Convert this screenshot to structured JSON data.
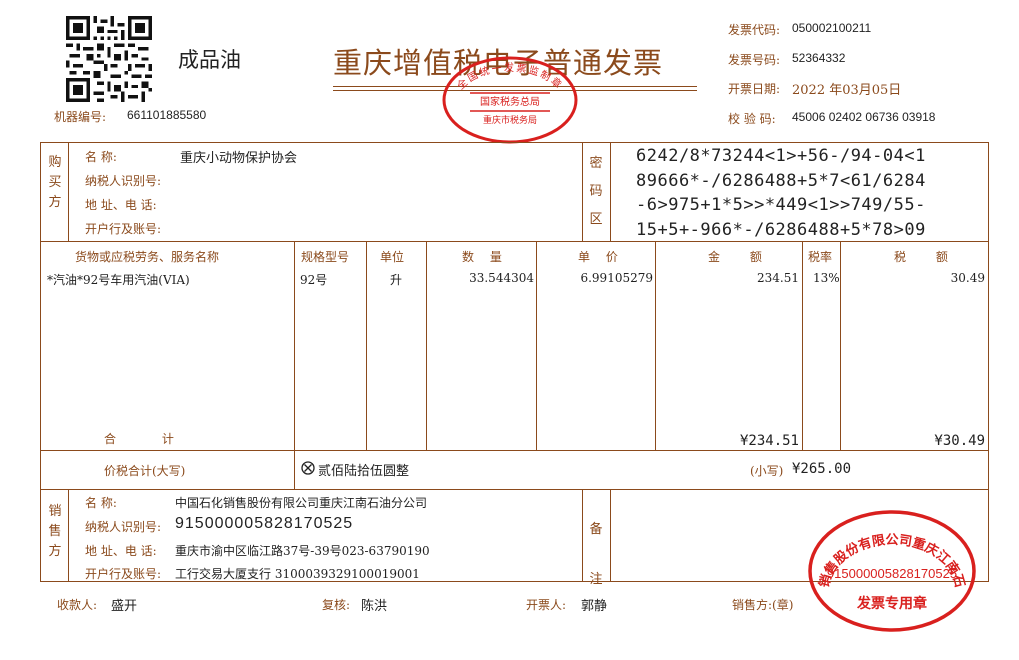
{
  "header": {
    "title": "重庆增值税电子普通发票",
    "category": "成品油",
    "machine_label": "机器编号:",
    "machine_no": "661101885580",
    "invoice_code_label": "发票代码:",
    "invoice_code": "050002100211",
    "invoice_no_label": "发票号码:",
    "invoice_no": "52364332",
    "date_label": "开票日期:",
    "date": "2022 年03月05日",
    "check_label": "校 验 码:",
    "check_code": "45006 02402 06736 03918"
  },
  "buyer": {
    "section": "购买方",
    "name_label": "名        称:",
    "name": "重庆小动物保护协会",
    "tax_label": "纳税人识别号:",
    "tax_id": "",
    "addr_label": "地 址、电 话:",
    "addr": "",
    "bank_label": "开户行及账号:",
    "bank": ""
  },
  "cipher": {
    "section": "密码区",
    "lines": [
      "6242/8*73244<1>+56-/94-04<1",
      "89666*-/6286488+5*7<61/6284",
      "-6>975+1*5>>*449<1>>749/55-",
      "15+5+-966*-/6286488+5*78>09"
    ]
  },
  "items": {
    "headers": {
      "name": "货物或应税劳务、服务名称",
      "spec": "规格型号",
      "unit": "单位",
      "qty": "数 量",
      "price": "单 价",
      "amount": "金 额",
      "rate": "税率",
      "tax": "税 额"
    },
    "rows": [
      {
        "name": "*汽油*92号车用汽油(VIA)",
        "spec": "92号",
        "unit": "升",
        "qty": "33.544304",
        "price": "6.99105279",
        "amount": "234.51",
        "rate": "13%",
        "tax": "30.49"
      }
    ],
    "total_label": "合 计",
    "total_amount": "¥234.51",
    "total_tax": "¥30.49"
  },
  "grand_total": {
    "label": "价税合计(大写)",
    "words": "贰佰陆拾伍圆整",
    "small_label": "(小写)",
    "small_value": "¥265.00"
  },
  "seller": {
    "section": "销售方",
    "name_label": "名        称:",
    "name": "中国石化销售股份有限公司重庆江南石油分公司",
    "tax_label": "纳税人识别号:",
    "tax_id": "915000005828170525",
    "addr_label": "地 址、电 话:",
    "addr": "重庆市渝中区临江路37号-39号023-63790190",
    "bank_label": "开户行及账号:",
    "bank": "工行交易大厦支行 3100039329100019001"
  },
  "remarks": {
    "label": "备注"
  },
  "footer": {
    "payee_label": "收款人:",
    "payee": "盛开",
    "reviewer_label": "复核:",
    "reviewer": "陈洪",
    "issuer_label": "开票人:",
    "issuer": "郭静",
    "seller_label": "销售方:(章)"
  },
  "seals": {
    "tax_bureau_top": "全国统一发票监制章",
    "tax_bureau_mid": "国家税务总局",
    "tax_bureau_bottom": "重庆市税务局",
    "seller_name": "中国石化销售股份有限公司重庆江南石油分公司",
    "seller_tax_id": "915000005828170525",
    "seller_seal_text": "发票专用章"
  }
}
